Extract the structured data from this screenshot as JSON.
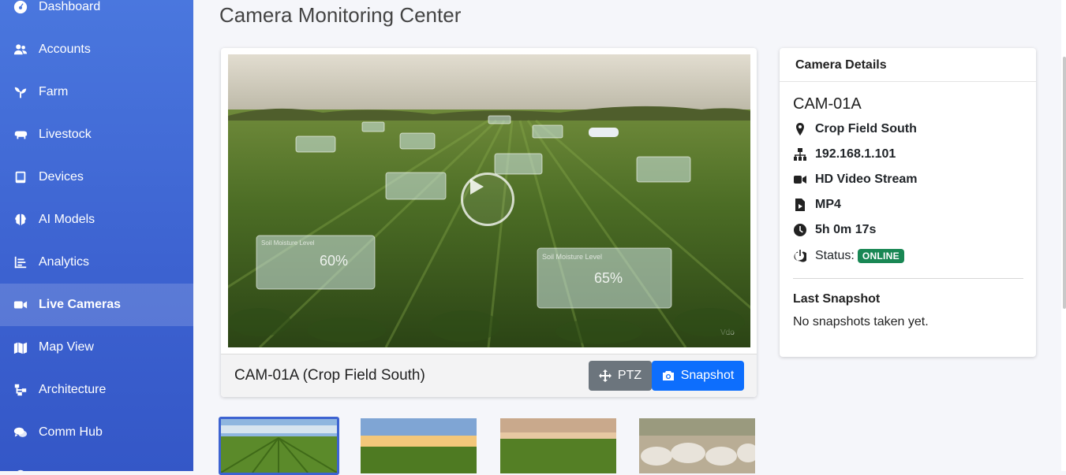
{
  "sidebar": {
    "items": [
      {
        "label": "Dashboard",
        "icon": "dashboard-icon"
      },
      {
        "label": "Accounts",
        "icon": "users-icon"
      },
      {
        "label": "Farm",
        "icon": "seedling-icon"
      },
      {
        "label": "Livestock",
        "icon": "cow-icon"
      },
      {
        "label": "Devices",
        "icon": "tablet-icon"
      },
      {
        "label": "AI Models",
        "icon": "brain-icon"
      },
      {
        "label": "Analytics",
        "icon": "chart-line-icon"
      },
      {
        "label": "Live Cameras",
        "icon": "video-icon",
        "active": true
      },
      {
        "label": "Map View",
        "icon": "map-icon"
      },
      {
        "label": "Architecture",
        "icon": "sitemap-icon"
      },
      {
        "label": "Comm Hub",
        "icon": "comments-icon"
      }
    ]
  },
  "page": {
    "title": "Camera Monitoring Center"
  },
  "player": {
    "caption": "CAM-01A (Crop Field South)",
    "ptz_label": "PTZ",
    "snapshot_label": "Snapshot",
    "overlay_values": [
      "60%",
      "65%"
    ],
    "overlay_labels": [
      "Soil Moisture Level",
      "Soil Moisture Level"
    ],
    "watermark": "Vdo"
  },
  "details": {
    "header": "Camera Details",
    "camera_id": "CAM-01A",
    "location": "Crop Field South",
    "ip": "192.168.1.101",
    "stream": "HD Video Stream",
    "format": "MP4",
    "uptime": "5h 0m 17s",
    "status_label": "Status:",
    "status_value": "ONLINE",
    "status_color": "#198754",
    "last_snapshot_title": "Last Snapshot",
    "last_snapshot_text": "No snapshots taken yet."
  },
  "thumbnails": [
    {
      "name": "crop-rows-sky",
      "selected": true
    },
    {
      "name": "corn-field-sunset",
      "selected": false
    },
    {
      "name": "corn-field-dusk",
      "selected": false
    },
    {
      "name": "cattle-herd",
      "selected": false
    }
  ],
  "colors": {
    "sidebar": "#4a77de",
    "primary": "#0d6efd",
    "secondary": "#6c757d",
    "online": "#198754"
  }
}
